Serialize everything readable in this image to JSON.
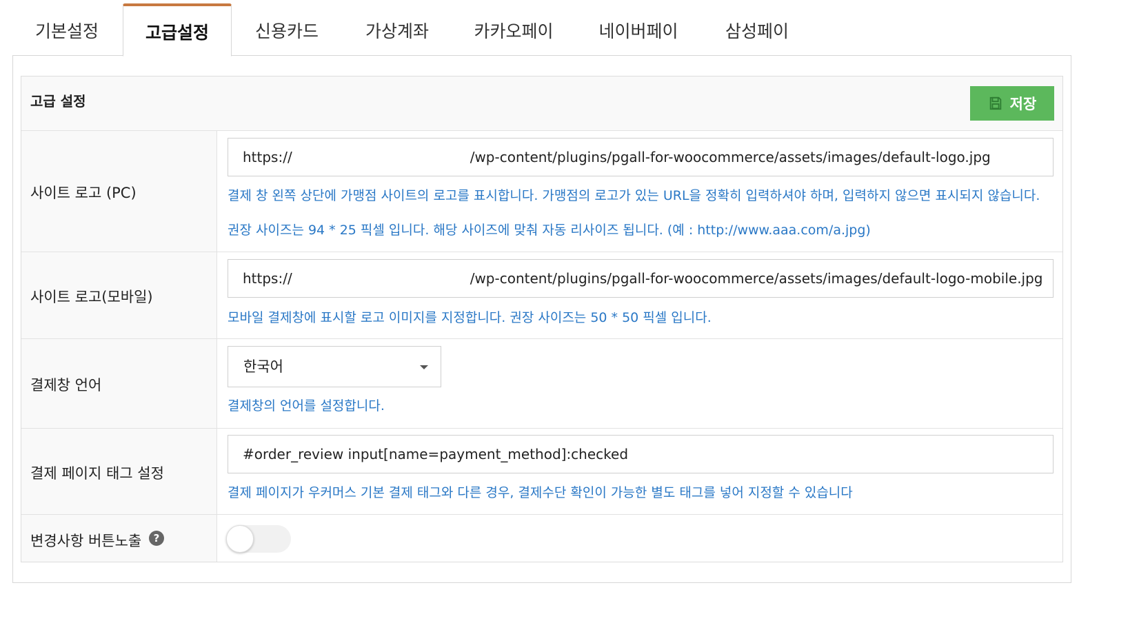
{
  "tabs": [
    {
      "label": "기본설정"
    },
    {
      "label": "고급설정"
    },
    {
      "label": "신용카드"
    },
    {
      "label": "가상계좌"
    },
    {
      "label": "카카오페이"
    },
    {
      "label": "네이버페이"
    },
    {
      "label": "삼성페이"
    }
  ],
  "active_tab": "고급설정",
  "panel": {
    "title": "고급 설정",
    "save_label": "저장",
    "save_icon": "floppy-disk-icon",
    "accent_color": "#5cb85c",
    "tab_accent_color": "#c87940"
  },
  "settings": {
    "site_logo_pc": {
      "label": "사이트 로고 (PC)",
      "value_prefix": "https://",
      "value_suffix": "/wp-content/plugins/pgall-for-woocommerce/assets/images/default-logo.jpg",
      "desc1": "결제 창 왼쪽 상단에 가맹점 사이트의 로고를 표시합니다. 가맹점의 로고가 있는 URL을 정확히 입력하셔야 하며, 입력하지 않으면 표시되지 않습니다.",
      "desc2": "권장 사이즈는 94 * 25 픽셀 입니다. 해당 사이즈에 맞춰 자동 리사이즈 됩니다. (예 : http://www.aaa.com/a.jpg)"
    },
    "site_logo_mobile": {
      "label": "사이트 로고(모바일)",
      "value_prefix": "https://",
      "value_suffix": "/wp-content/plugins/pgall-for-woocommerce/assets/images/default-logo-mobile.jpg",
      "desc": "모바일 결제창에 표시할 로고 이미지를 지정합니다. 권장 사이즈는 50 * 50 픽셀 입니다."
    },
    "language": {
      "label": "결제창 언어",
      "selected": "한국어",
      "desc": "결제창의 언어를 설정합니다."
    },
    "payment_tag": {
      "label": "결제 페이지 태그 설정",
      "value": "#order_review input[name=payment_method]:checked",
      "desc": "결제 페이지가 우커머스 기본 결제 태그와 다른 경우, 결제수단 확인이 가능한 별도 태그를 넣어 지정할 수 있습니다"
    },
    "show_changes_button": {
      "label": "변경사항 버튼노출",
      "help_icon": "question-circle-icon",
      "enabled": false
    }
  }
}
